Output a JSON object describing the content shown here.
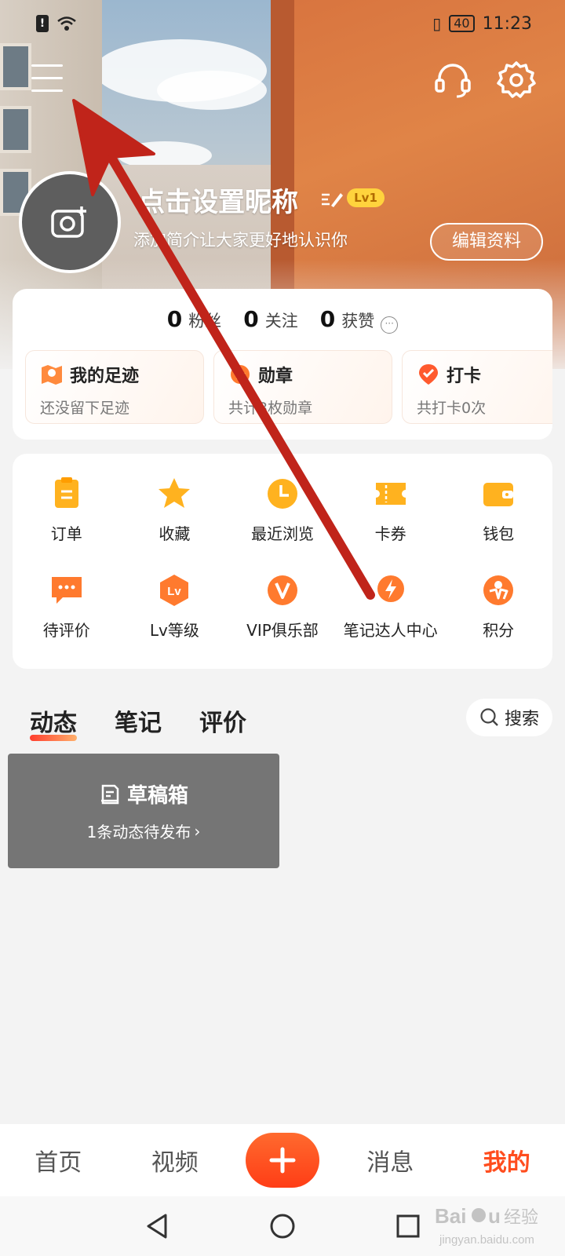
{
  "status_bar": {
    "battery": "40",
    "time": "11:23"
  },
  "profile": {
    "nickname": "点击设置昵称",
    "level_badge": "Lv1",
    "bio_placeholder": "添加简介让大家更好地认识你",
    "edit_profile_label": "编辑资料"
  },
  "stats": [
    {
      "value": "0",
      "label": "粉丝"
    },
    {
      "value": "0",
      "label": "关注"
    },
    {
      "value": "0",
      "label": "获赞"
    }
  ],
  "quick_cards": [
    {
      "title": "我的足迹",
      "subtitle": "还没留下足迹",
      "icon": "map-icon"
    },
    {
      "title": "勋章",
      "subtitle": "共计3枚勋章",
      "icon": "medal-icon"
    },
    {
      "title": "打卡",
      "subtitle": "共打卡0次",
      "icon": "checkin-icon"
    }
  ],
  "services": [
    {
      "label": "订单",
      "icon": "order-icon"
    },
    {
      "label": "收藏",
      "icon": "star-icon"
    },
    {
      "label": "最近浏览",
      "icon": "clock-icon"
    },
    {
      "label": "卡券",
      "icon": "ticket-icon"
    },
    {
      "label": "钱包",
      "icon": "wallet-icon"
    },
    {
      "label": "待评价",
      "icon": "comment-icon"
    },
    {
      "label": "Lv等级",
      "icon": "level-icon"
    },
    {
      "label": "VIP俱乐部",
      "icon": "vip-icon"
    },
    {
      "label": "笔记达人中心",
      "icon": "lightning-icon"
    },
    {
      "label": "积分",
      "icon": "points-icon"
    }
  ],
  "content_tabs": [
    {
      "label": "动态",
      "active": true
    },
    {
      "label": "笔记",
      "active": false
    },
    {
      "label": "评价",
      "active": false
    }
  ],
  "search_label": "搜索",
  "drafts": {
    "title": "草稿箱",
    "subtitle": "1条动态待发布"
  },
  "bottom_nav": [
    {
      "label": "首页"
    },
    {
      "label": "视频"
    },
    {
      "label": "消息"
    },
    {
      "label": "我的",
      "active": true
    }
  ],
  "colors": {
    "accent": "#ff4d1e",
    "annotation_arrow": "#c0241a",
    "service_icon": "#ffb21f"
  }
}
